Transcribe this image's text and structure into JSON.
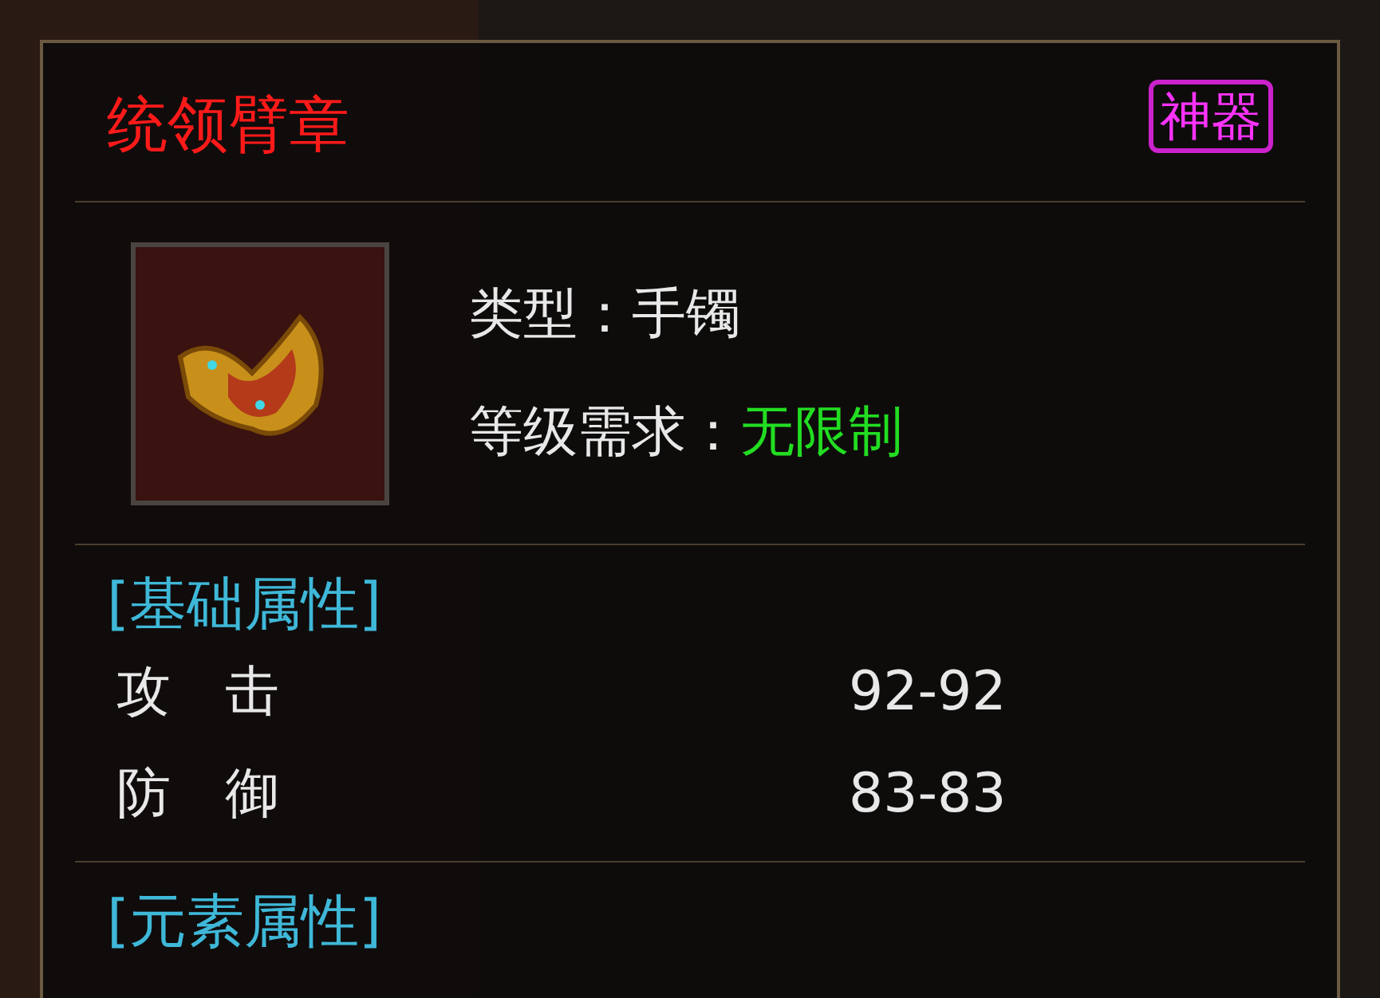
{
  "item": {
    "name": "统领臂章",
    "badge": "神器",
    "fields": [
      {
        "label": "类型：",
        "value": "手镯",
        "kind": "plain"
      },
      {
        "label": "等级需求：",
        "value": "无限制",
        "kind": "ok"
      }
    ]
  },
  "sections": [
    {
      "title": "[基础属性]",
      "stats": [
        {
          "name": "攻　击",
          "value": "92-92"
        },
        {
          "name": "防　御",
          "value": "83-83"
        }
      ]
    },
    {
      "title": "[元素属性]"
    }
  ]
}
